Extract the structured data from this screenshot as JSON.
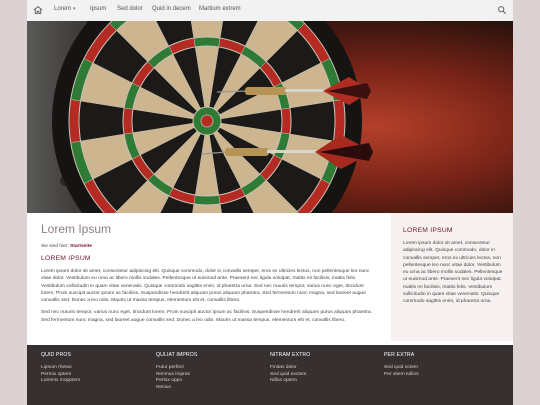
{
  "nav": {
    "items": [
      {
        "label": "Lorem"
      },
      {
        "label": "Ipsum"
      },
      {
        "label": "Sed dolor"
      },
      {
        "label": "Quid in decem"
      },
      {
        "label": "Martium extrem"
      }
    ],
    "home_icon": "home-icon",
    "search_icon": "search-icon"
  },
  "hero": {
    "subject": "dartboard-with-darts"
  },
  "main": {
    "title": "Lorem Ipsum",
    "breadcrumb_prefix": "Sie sind hier:",
    "breadcrumb_link": "Startseite",
    "heading": "LOREM IPSUM",
    "paragraphs": [
      "Lorem ipsum dolor sit amet, consectetur adipiscing elit. Quisque commodo, dolor in convallis semper, eros ex ultricies lectus, non pellentesque leo nunc vitae dolor. Vestibulum eu urna ac libero mollis sodales. Pellentesque ut euismod ante. Praesent nec ligula volutpat, mattis mi facilisis, mattis felis. Vestibulum sollicitudin in quam vitae venenatis. Quisque commodo sagittis enim, id pharetra urna. Sed nec mauris tempor, varius nunc eget, tincidunt lorem. Proin suscipit auctor ipsum ac facilisis. Suspendisse hendrerit aliquam purus aliquam pharetra. Sed fermentum nunc magna, sed laoreet augue convallis sed. Donec a leo odio. Mauris ut massa tempus, elementum elit et, convallis libero.",
      "Sed nec mauris tempor, varius nunc eget, tincidunt lorem. Proin suscipit auctor ipsum ac facilisis. Suspendisse hendrerit aliquam purus aliquam pharetra. Sed fermentum nunc magna, sed laoreet augue convallis sed. Donec a leo odio. Mauris ut massa tempus, elementum elit et, convallis libero."
    ]
  },
  "sidebar": {
    "heading": "LOREM IPSUM",
    "text": "Lorem ipsum dolor sit amet, consectetur adipiscing elit. Quisque commodo, dolor in convallis semper, eros ex ultricies lectus, non pellentesque leo nunc vitae dolor. Vestibulum eu urna ac libero mollis sodales. Pellentesque ut euismod ante. Praesent nec ligula volutpat, mattis mi facilisis, mattis felis. Vestibulum sollicitudin in quam vitae venenatis. Quisque commodo sagittis enim, id pharetra urna."
  },
  "footer": {
    "columns": [
      {
        "title": "QUID PROS",
        "links": [
          "Lipsum rhetus",
          "Permix optem",
          "Loremix mopptem"
        ]
      },
      {
        "title": "QULIAT IMPROS",
        "links": [
          "Futur perfect",
          "Nimmus impras",
          "Perlox oppo",
          "Nimius"
        ]
      },
      {
        "title": "NITRAM EXTRO",
        "links": [
          "Finitas dolor",
          "Sed quid exctem",
          "Nillus optem"
        ]
      },
      {
        "title": "PER EXTRA",
        "links": [
          "Sed quid octem",
          "Per sitem tullios"
        ]
      }
    ]
  },
  "colors": {
    "accent": "#7a0f2a",
    "title_gray": "#8f7f7f",
    "footer_bg": "#363030",
    "sidebar_bg": "#f8f1f1",
    "page_bg": "#ddd2d2"
  }
}
